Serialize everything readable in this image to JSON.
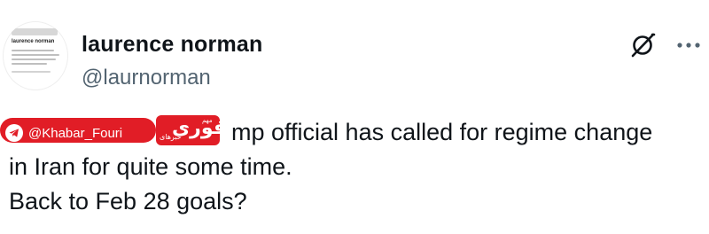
{
  "author": {
    "display_name": "laurence norman",
    "handle": "@laurnorman",
    "avatar_name": "laurence norman"
  },
  "tweet": {
    "line1": "mp official has called for regime change",
    "line2": "in Iran for quite some time.",
    "line3": "Back to Feb 28 goals?"
  },
  "watermark": {
    "channel": "@Khabar_Fouri",
    "logo_main": "فوری",
    "logo_sub": "خبرهای",
    "logo_tag": "مهم",
    "colors": {
      "brand": "#e11d26"
    },
    "icon": "telegram-icon"
  },
  "icons": {
    "grok": "grok-icon",
    "more": "more-icon"
  },
  "colors": {
    "text": "#0f1419",
    "secondary": "#536471"
  }
}
